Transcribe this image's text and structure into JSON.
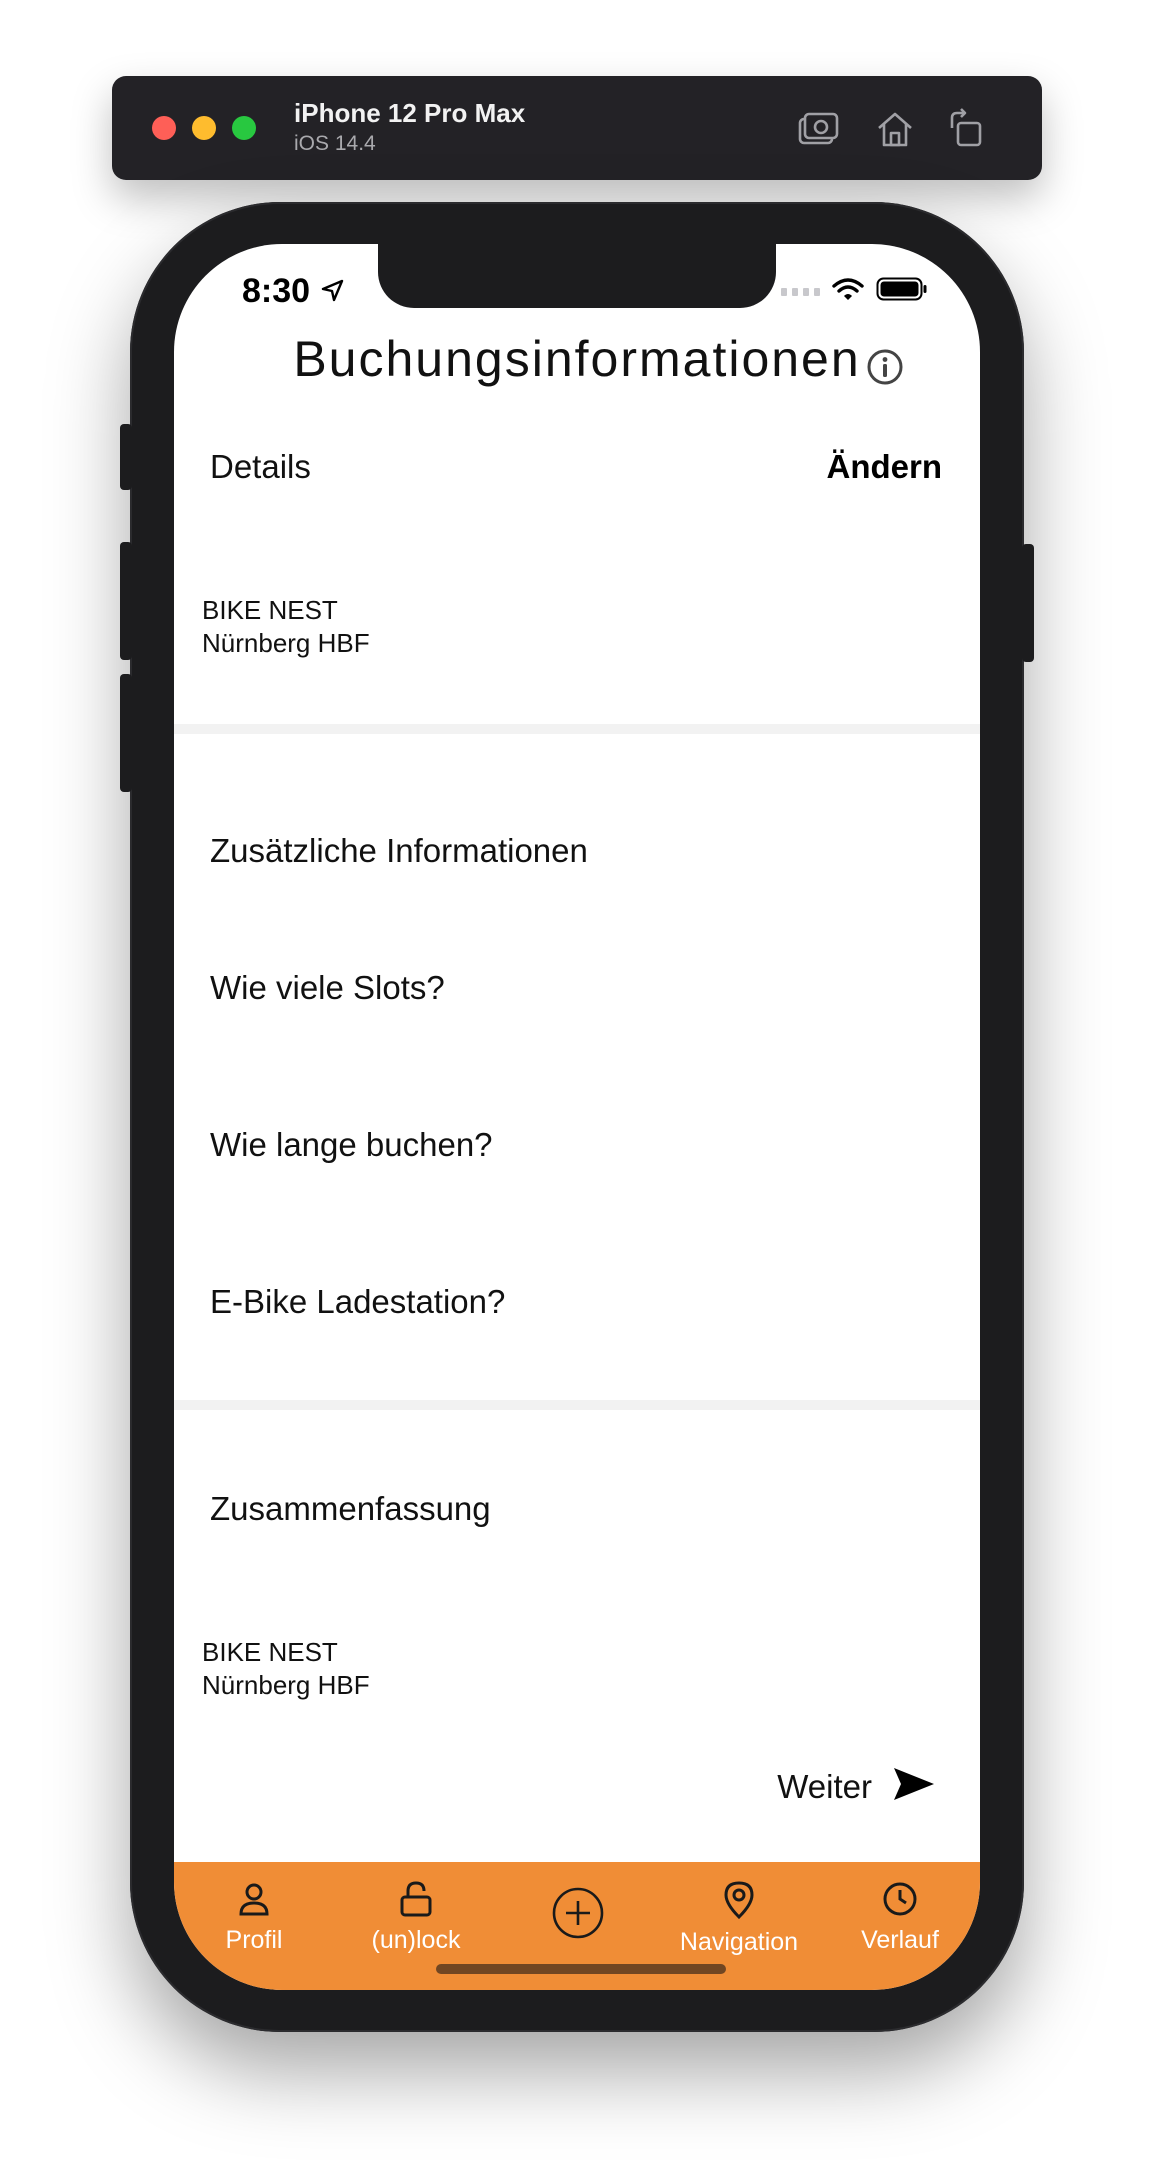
{
  "simulator": {
    "device": "iPhone 12 Pro Max",
    "os": "iOS 14.4",
    "buttons": [
      "screenshot-icon",
      "home-icon",
      "rotate-icon"
    ]
  },
  "status_bar": {
    "time": "8:30"
  },
  "header": {
    "title": "Buchungsinformationen"
  },
  "details": {
    "label": "Details",
    "edit_label": "Ändern",
    "address_line1": "BIKE NEST",
    "address_line2": "Nürnberg HBF"
  },
  "additional": {
    "title": "Zusätzliche Informationen",
    "q_slots": "Wie viele Slots?",
    "q_duration": "Wie lange buchen?",
    "q_ebike": "E-Bike Ladestation?"
  },
  "summary": {
    "title": "Zusammenfassung",
    "address_line1": "BIKE NEST",
    "address_line2": "Nürnberg HBF"
  },
  "next_button": {
    "label": "Weiter"
  },
  "tabs": [
    {
      "label": "Profil",
      "icon": "person-icon"
    },
    {
      "label": "(un)lock",
      "icon": "unlock-icon"
    },
    {
      "label": "",
      "icon": "plus-circle-icon"
    },
    {
      "label": "Navigation",
      "icon": "location-pin-icon"
    },
    {
      "label": "Verlauf",
      "icon": "clock-icon"
    }
  ],
  "colors": {
    "accent": "#f08d36",
    "bezel": "#1c1c1e",
    "divider": "#f2f2f2"
  }
}
